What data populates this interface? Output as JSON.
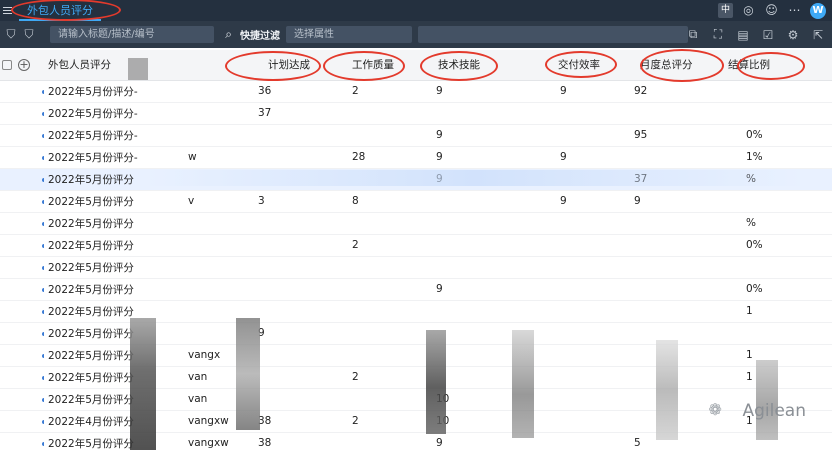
{
  "header": {
    "app_tab": "外包人员评分",
    "lang": "中",
    "logo_letter": "W"
  },
  "filter": {
    "search_placeholder": "请输入标题/描述/编号",
    "quick_filter_label": "快捷过滤",
    "attribute_placeholder": "选择属性"
  },
  "table": {
    "columns": {
      "name": "外包人员评分",
      "plan": "计划达成",
      "quality": "工作质量",
      "tech": "技术技能",
      "delivery": "交付效率",
      "monthly": "月度总评分",
      "ratio": "结算比例"
    },
    "rows": [
      {
        "name": "2022年5月份评分-",
        "g": "",
        "plan": "36",
        "qual": "2",
        "tech": "9",
        "del": "9",
        "mon": "92",
        "rat": ""
      },
      {
        "name": "2022年5月份评分-",
        "g": "",
        "plan": "37",
        "qual": "",
        "tech": "",
        "del": "",
        "mon": "",
        "rat": ""
      },
      {
        "name": "2022年5月份评分-",
        "g": "",
        "plan": "",
        "qual": "",
        "tech": "9",
        "del": "",
        "mon": "95",
        "rat": "0%"
      },
      {
        "name": "2022年5月份评分-",
        "g": "w",
        "plan": "",
        "qual": "28",
        "tech": "9",
        "del": "9",
        "mon": "",
        "rat": "1%"
      },
      {
        "name": "2022年5月份评分",
        "g": "",
        "plan": "",
        "qual": "",
        "tech": "9",
        "del": "",
        "mon": "37",
        "rat": "%"
      },
      {
        "name": "2022年5月份评分",
        "g": "v",
        "plan": "3",
        "qual": "8",
        "tech": "",
        "del": "9",
        "mon": "9",
        "rat": ""
      },
      {
        "name": "2022年5月份评分",
        "g": "",
        "plan": "",
        "qual": "",
        "tech": "",
        "del": "",
        "mon": "",
        "rat": "%"
      },
      {
        "name": "2022年5月份评分",
        "g": "",
        "plan": "",
        "qual": "2",
        "tech": "",
        "del": "",
        "mon": "",
        "rat": "0%"
      },
      {
        "name": "2022年5月份评分",
        "g": "",
        "plan": "",
        "qual": "",
        "tech": "",
        "del": "",
        "mon": "",
        "rat": ""
      },
      {
        "name": "2022年5月份评分",
        "g": "",
        "plan": "",
        "qual": "",
        "tech": "9",
        "del": "",
        "mon": "",
        "rat": "0%"
      },
      {
        "name": "2022年5月份评分",
        "g": "",
        "plan": "",
        "qual": "",
        "tech": "",
        "del": "",
        "mon": "",
        "rat": "1"
      },
      {
        "name": "2022年5月份评分",
        "g": "",
        "plan": "9",
        "qual": "",
        "tech": "",
        "del": "",
        "mon": "",
        "rat": ""
      },
      {
        "name": "2022年5月份评分",
        "g": "vangx",
        "plan": "",
        "qual": "",
        "tech": "",
        "del": "",
        "mon": "",
        "rat": "1"
      },
      {
        "name": "2022年5月份评分",
        "g": "van",
        "plan": "",
        "qual": "2",
        "tech": "",
        "del": "",
        "mon": "",
        "rat": "1"
      },
      {
        "name": "2022年5月份评分",
        "g": "van",
        "plan": "",
        "qual": "",
        "tech": "10",
        "del": "",
        "mon": "",
        "rat": ""
      },
      {
        "name": "2022年4月份评分",
        "g": "vangxw",
        "plan": "38",
        "qual": "2",
        "tech": "10",
        "del": "",
        "mon": "",
        "rat": "1"
      },
      {
        "name": "2022年5月份评分",
        "g": "vangxw",
        "plan": "38",
        "qual": "",
        "tech": "9",
        "del": "",
        "mon": "5",
        "rat": ""
      }
    ]
  },
  "watermark": {
    "text": "Agilean"
  }
}
